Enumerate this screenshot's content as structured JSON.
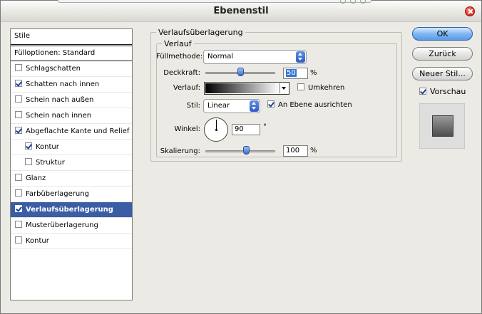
{
  "window": {
    "title": "Ebenenstil"
  },
  "sidebar": {
    "header": "Stile",
    "blend_options": "Fülloptionen: Standard",
    "items": [
      {
        "label": "Schlagschatten",
        "checked": false,
        "indent": false,
        "selected": false
      },
      {
        "label": "Schatten nach innen",
        "checked": true,
        "indent": false,
        "selected": false
      },
      {
        "label": "Schein nach außen",
        "checked": false,
        "indent": false,
        "selected": false
      },
      {
        "label": "Schein nach innen",
        "checked": false,
        "indent": false,
        "selected": false
      },
      {
        "label": "Abgeflachte Kante und Relief",
        "checked": true,
        "indent": false,
        "selected": false
      },
      {
        "label": "Kontur",
        "checked": true,
        "indent": true,
        "selected": false
      },
      {
        "label": "Struktur",
        "checked": false,
        "indent": true,
        "selected": false
      },
      {
        "label": "Glanz",
        "checked": false,
        "indent": false,
        "selected": false
      },
      {
        "label": "Farbüberlagerung",
        "checked": false,
        "indent": false,
        "selected": false
      },
      {
        "label": "Verlaufsüberlagerung",
        "checked": true,
        "indent": false,
        "selected": true
      },
      {
        "label": "Musterüberlagerung",
        "checked": false,
        "indent": false,
        "selected": false
      },
      {
        "label": "Kontur",
        "checked": false,
        "indent": false,
        "selected": false
      }
    ]
  },
  "panel": {
    "group_title": "Verlaufsüberlagerung",
    "subgroup_title": "Verlauf",
    "blend_mode": {
      "label": "Füllmethode:",
      "value": "Normal"
    },
    "opacity": {
      "label": "Deckkraft:",
      "value": "50",
      "unit": "%",
      "level": 0.5
    },
    "gradient": {
      "label": "Verlauf:"
    },
    "reverse": {
      "label": "Umkehren",
      "checked": false
    },
    "style": {
      "label": "Stil:",
      "value": "Linear"
    },
    "align_layer": {
      "label": "An Ebene ausrichten",
      "checked": true
    },
    "angle": {
      "label": "Winkel:",
      "value": "90",
      "unit": "°"
    },
    "scale": {
      "label": "Skalierung:",
      "value": "100",
      "unit": "%",
      "level": 0.6
    }
  },
  "buttons": {
    "ok": "OK",
    "cancel": "Zurück",
    "new_style": "Neuer Stil...",
    "preview_label": "Vorschau",
    "preview_checked": true
  },
  "colors": {
    "accent": "#3b5da4",
    "button_primary": "#7fb7f2",
    "close": "#d7261c"
  }
}
